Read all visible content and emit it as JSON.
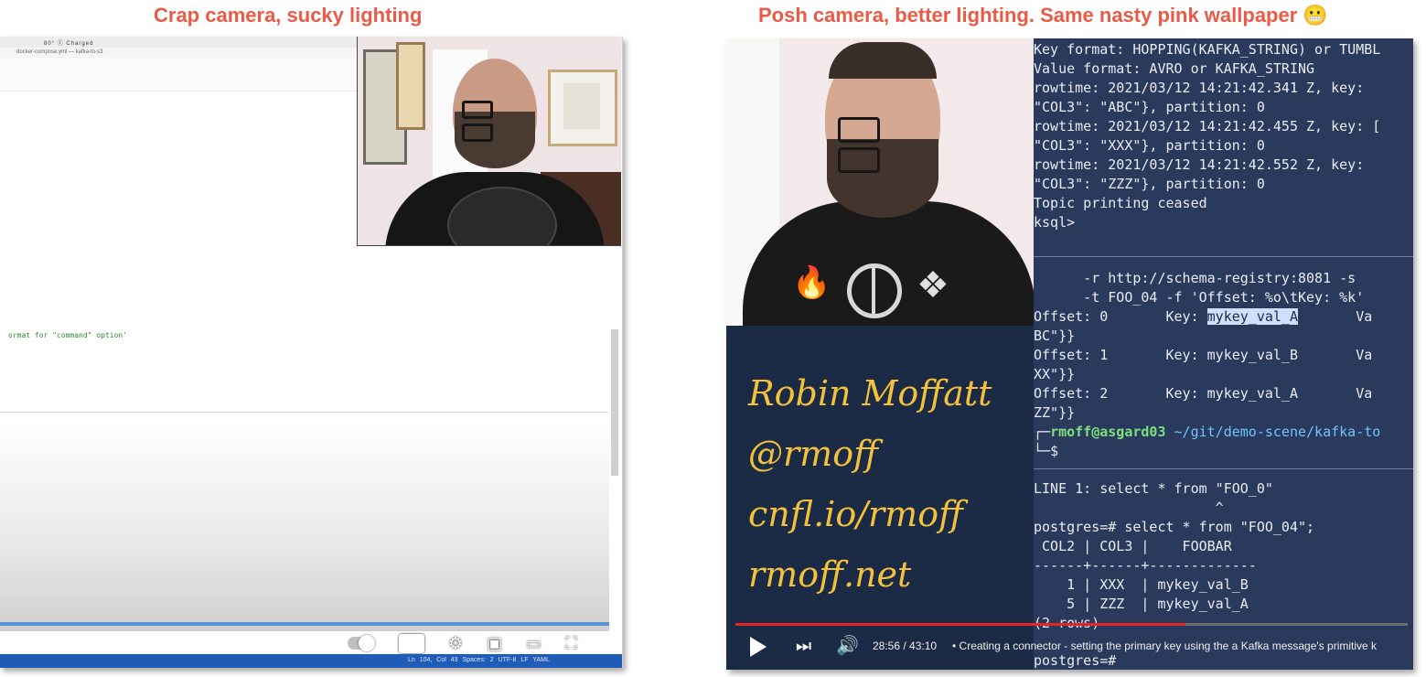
{
  "captions": {
    "left": "Crap camera, sucky lighting",
    "right": "Posh camera, better lighting. Same nasty pink wallpaper 😬"
  },
  "left_window": {
    "menubar_status": "80° ⓒ Charged",
    "title": "docker-compose.yml — kafka-to-s3",
    "code_fragment": "ormat for \"command\" option'",
    "statusbar": "Ln 104, Col 43   Spaces: 2   UTF-8   LF   YAML",
    "cc_label": "CC"
  },
  "right_window": {
    "terminal_lines": [
      "Key format: HOPPING(KAFKA_STRING) or TUMBL",
      "Value format: AVRO or KAFKA_STRING",
      "rowtime: 2021/03/12 14:21:42.341 Z, key:",
      "\"COL3\": \"ABC\"}, partition: 0",
      "rowtime: 2021/03/12 14:21:42.455 Z, key: [",
      "\"COL3\": \"XXX\"}, partition: 0",
      "rowtime: 2021/03/12 14:21:42.552 Z, key:",
      "\"COL3\": \"ZZZ\"}, partition: 0",
      "Topic printing ceased",
      "ksql>"
    ],
    "kafkacat_lines": [
      "      -r http://schema-registry:8081 -s",
      "      -t FOO_04 -f 'Offset: %o\\tKey: %k'"
    ],
    "offset_lines": [
      {
        "offset": "Offset: 0",
        "key_label": "Key: ",
        "key_value": "mykey_val_A",
        "tail": "Va",
        "wrap": "BC\"}}"
      },
      {
        "offset": "Offset: 1",
        "key_label": "Key: ",
        "key_value": "mykey_val_B",
        "tail": "Va",
        "wrap": "XX\"}}"
      },
      {
        "offset": "Offset: 2",
        "key_label": "Key: ",
        "key_value": "mykey_val_A",
        "tail": "Va",
        "wrap": "ZZ\"}}"
      }
    ],
    "prompt_user": "rmoff@asgard03",
    "prompt_path": " ~/git/demo-scene/kafka-to",
    "prompt_dollar": "$",
    "psql_lines": [
      "LINE 1: select * from \"FOO_0\"",
      "                      ^",
      "postgres=# select * from \"FOO_04\";",
      " COL2 | COL3 |    FOOBAR",
      "------+------+-------------",
      "    1 | XXX  | mykey_val_B",
      "    5 | ZZZ  | mykey_val_A",
      "(2 rows)",
      "postgres=#"
    ],
    "info": [
      "Robin Moffatt",
      "@rmoff",
      "cnfl.io/rmoff",
      "rmoff.net"
    ],
    "player": {
      "time": "28:56 / 43:10",
      "chapter": "• Creating a connector - setting the primary key using the a Kafka message's primitive k",
      "progress": 0.67
    }
  }
}
